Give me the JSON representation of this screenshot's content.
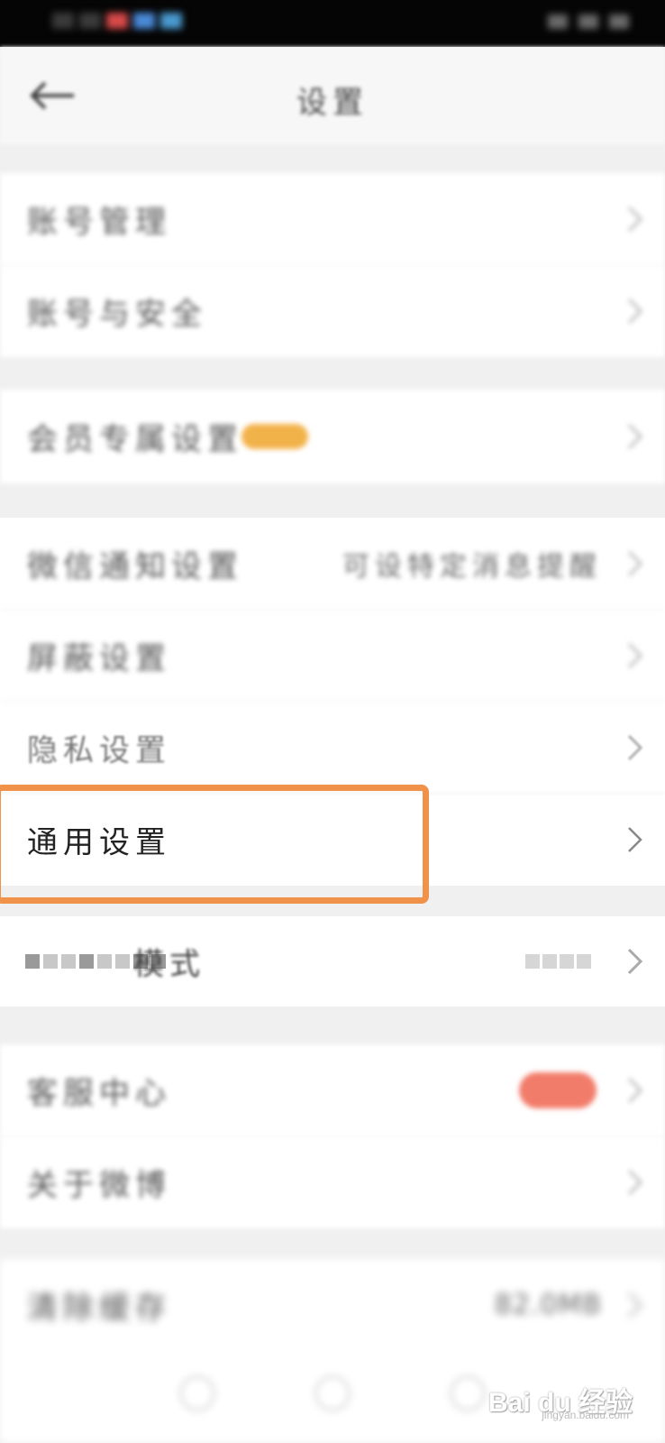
{
  "status_bar": {
    "left_colors": [
      "#3a3a3a",
      "#3a3a3a",
      "#d84a4a",
      "#4a8ad8",
      "#4a9ad0"
    ]
  },
  "header": {
    "title": "设置",
    "back_icon": "back-arrow-icon"
  },
  "groups": [
    {
      "items": [
        {
          "label": "账号管理",
          "icon": "chevron-right-icon"
        },
        {
          "label": "账号与安全",
          "icon": "chevron-right-icon"
        }
      ]
    },
    {
      "items": [
        {
          "label": "会员专属设置",
          "badge_color": "#f2b24a",
          "icon": "chevron-right-icon"
        }
      ]
    },
    {
      "items": [
        {
          "label": "微信通知设置",
          "value": "可设特定消息提醒",
          "icon": "chevron-right-icon"
        },
        {
          "label": "屏蔽设置",
          "icon": "chevron-right-icon"
        },
        {
          "label": "隐私设置",
          "icon": "chevron-right-icon"
        },
        {
          "label": "通用设置",
          "icon": "chevron-right-icon",
          "highlight_color": "#f0924a"
        }
      ]
    },
    {
      "items": [
        {
          "label": "模式",
          "icon": "chevron-right-icon"
        }
      ]
    },
    {
      "items": [
        {
          "label": "客服中心",
          "badge_color": "#f27c6a",
          "icon": "chevron-right-icon"
        },
        {
          "label": "关于微博",
          "icon": "chevron-right-icon"
        }
      ]
    },
    {
      "items": [
        {
          "label": "清除缓存",
          "value": "82.0MB",
          "icon": "chevron-right-icon"
        }
      ]
    }
  ],
  "watermark": {
    "brand": "Bai du 经验",
    "url": "jingyan.baidu.com"
  }
}
